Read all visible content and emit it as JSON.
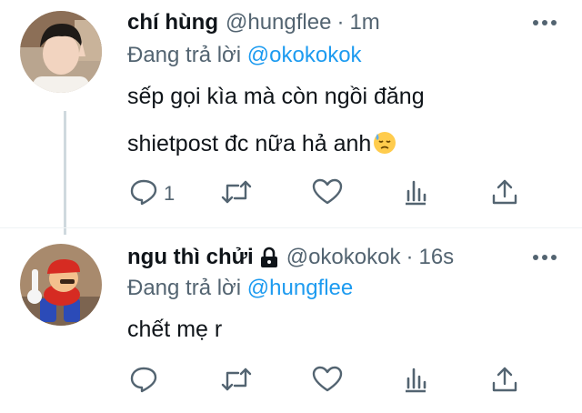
{
  "tweets": [
    {
      "name": "chí hùng",
      "handle": "@hungflee",
      "separator": "·",
      "time": "1m",
      "replying_prefix": "Đang trả lời ",
      "replying_to": "@okokokok",
      "text_lines": [
        "sếp gọi kìa mà còn ngồi đăng",
        "shietpost đc nữa hả anh"
      ],
      "emoji": "downcast-face-with-sweat",
      "reply_count": "1",
      "protected": false
    },
    {
      "name": "ngu thì chửi",
      "handle": "@okokokok",
      "separator": "·",
      "time": "16s",
      "replying_prefix": "Đang trả lời ",
      "replying_to": "@hungflee",
      "text_lines": [
        "chết mẹ r"
      ],
      "reply_count": "",
      "protected": true
    }
  ],
  "colors": {
    "text": "#0f1419",
    "secondary": "#536471",
    "accent": "#1d9bf0",
    "thread_line": "#cfd9de"
  },
  "icons": [
    "reply-icon",
    "retweet-icon",
    "like-icon",
    "analytics-icon",
    "share-icon",
    "more-icon",
    "lock-icon"
  ]
}
